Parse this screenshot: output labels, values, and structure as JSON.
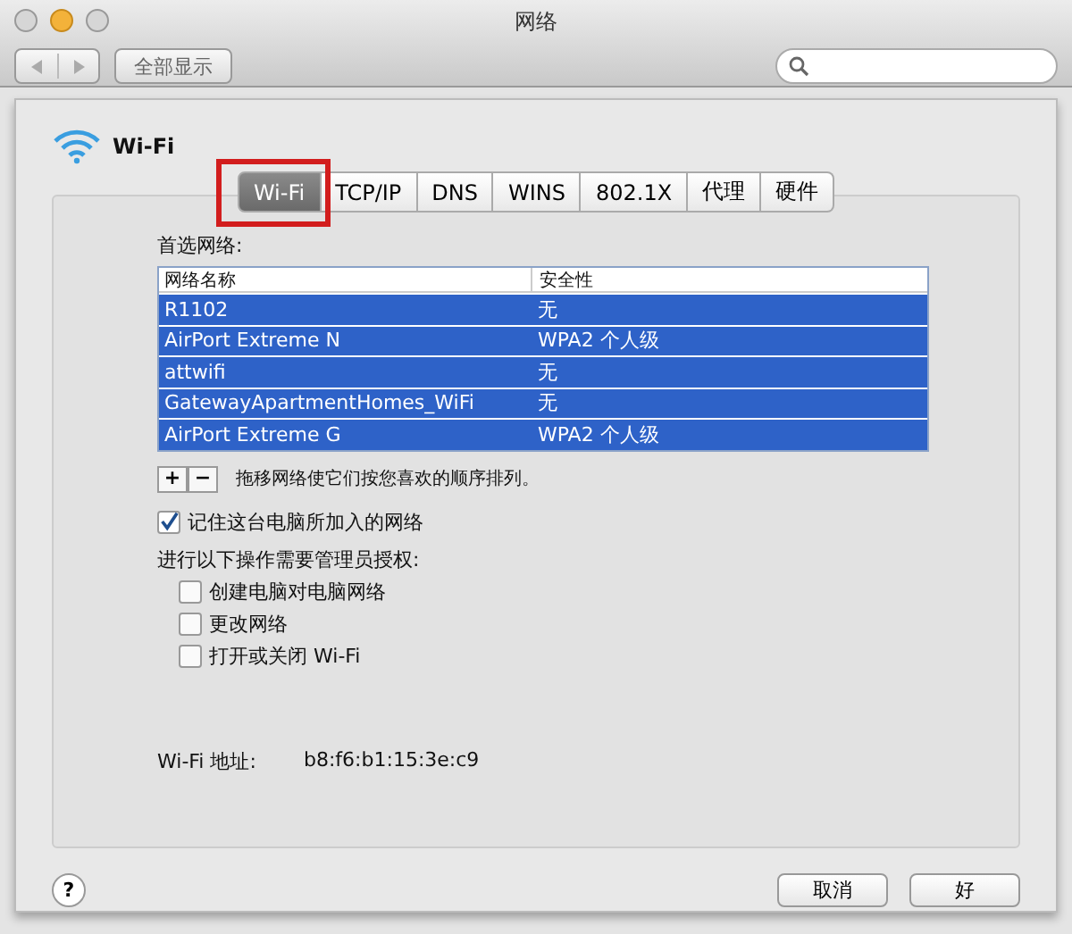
{
  "window": {
    "title": "网络",
    "show_all": "全部显示"
  },
  "service": {
    "name": "Wi-Fi"
  },
  "tabs": [
    {
      "label": "Wi-Fi",
      "selected": true,
      "highlighted": true
    },
    {
      "label": "TCP/IP",
      "selected": false,
      "highlighted": false
    },
    {
      "label": "DNS",
      "selected": false,
      "highlighted": false
    },
    {
      "label": "WINS",
      "selected": false,
      "highlighted": false
    },
    {
      "label": "802.1X",
      "selected": false,
      "highlighted": false
    },
    {
      "label": "代理",
      "selected": false,
      "highlighted": false
    },
    {
      "label": "硬件",
      "selected": false,
      "highlighted": false
    }
  ],
  "preferred": {
    "label": "首选网络:",
    "columns": [
      "网络名称",
      "安全性"
    ],
    "rows": [
      {
        "name": "R1102",
        "security": "无",
        "selected": true
      },
      {
        "name": "AirPort Extreme N",
        "security": "WPA2 个人级",
        "selected": true
      },
      {
        "name": "attwifi",
        "security": "无",
        "selected": true
      },
      {
        "name": "GatewayApartmentHomes_WiFi",
        "security": "无",
        "selected": true
      },
      {
        "name": "AirPort Extreme G",
        "security": "WPA2 个人级",
        "selected": true
      }
    ],
    "add": "+",
    "remove": "−",
    "hint": "拖移网络使它们按您喜欢的顺序排列。"
  },
  "remember": {
    "label": "记住这台电脑所加入的网络",
    "checked": true
  },
  "admin": {
    "label": "进行以下操作需要管理员授权:",
    "options": [
      {
        "label": "创建电脑对电脑网络",
        "checked": false
      },
      {
        "label": "更改网络",
        "checked": false
      },
      {
        "label": "打开或关闭 Wi-Fi",
        "checked": false
      }
    ]
  },
  "address": {
    "label": "Wi-Fi 地址:",
    "value": "b8:f6:b1:15:3e:c9"
  },
  "help": "?",
  "buttons": [
    "取消",
    "好"
  ]
}
